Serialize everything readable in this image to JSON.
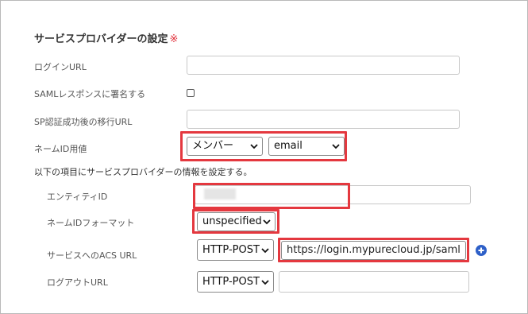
{
  "section": {
    "title": "サービスプロバイダーの設定",
    "required_mark": "※"
  },
  "fields": {
    "login_url": {
      "label": "ログインURL",
      "value": ""
    },
    "saml_sign": {
      "label": "SAMLレスポンスに署名する",
      "checked": false
    },
    "sp_redirect_url": {
      "label": "SP認証成功後の移行URL",
      "value": ""
    },
    "name_id": {
      "label": "ネームID用値",
      "source": "メンバー",
      "attribute": "email"
    }
  },
  "sp_info": {
    "heading": "以下の項目にサービスプロバイダーの情報を設定する。",
    "entity_id": {
      "label": "エンティティID",
      "value": ""
    },
    "name_id_format": {
      "label": "ネームIDフォーマット",
      "value": "unspecified"
    },
    "acs_url": {
      "label": "サービスへのACS URL",
      "binding": "HTTP-POST",
      "value": "https://login.mypurecloud.jp/saml"
    },
    "logout_url": {
      "label": "ログアウトURL",
      "binding": "HTTP-POST",
      "value": ""
    }
  },
  "colors": {
    "highlight": "#e4383f",
    "required": "#e0303a",
    "add_button": "#2e60c8"
  },
  "icons": {
    "select_arrow": "chevron-down-icon",
    "add": "plus-circle-icon"
  }
}
